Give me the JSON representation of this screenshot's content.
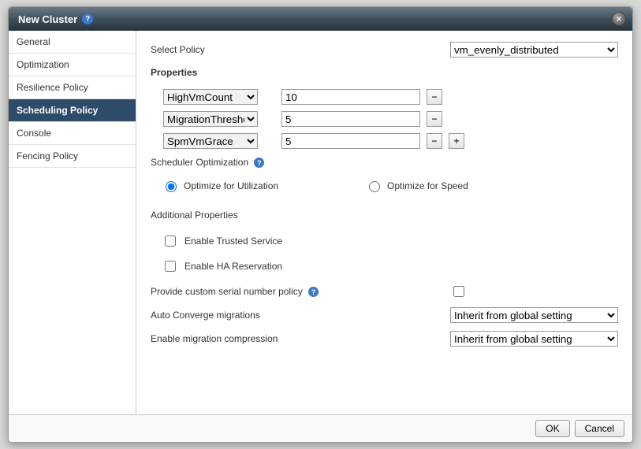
{
  "dialog": {
    "title": "New Cluster"
  },
  "sidebar": {
    "items": [
      {
        "label": "General"
      },
      {
        "label": "Optimization"
      },
      {
        "label": "Resilience Policy"
      },
      {
        "label": "Scheduling Policy"
      },
      {
        "label": "Console"
      },
      {
        "label": "Fencing Policy"
      }
    ],
    "active_index": 3
  },
  "content": {
    "select_policy_label": "Select Policy",
    "policy_value": "vm_evenly_distributed",
    "properties_title": "Properties",
    "properties": [
      {
        "key": "HighVmCount",
        "value": "10",
        "show_minus": true,
        "show_plus": false
      },
      {
        "key": "MigrationThreshold",
        "value": "5",
        "show_minus": true,
        "show_plus": false
      },
      {
        "key": "SpmVmGrace",
        "value": "5",
        "show_minus": true,
        "show_plus": true
      }
    ],
    "scheduler_opt_title": "Scheduler Optimization",
    "radio_utilization": "Optimize for Utilization",
    "radio_speed": "Optimize for Speed",
    "radio_selected": "utilization",
    "additional_title": "Additional Properties",
    "cb_trusted": "Enable Trusted Service",
    "cb_ha": "Enable HA Reservation",
    "serial_label": "Provide custom serial number policy",
    "serial_checked": false,
    "auto_converge_label": "Auto Converge migrations",
    "auto_converge_value": "Inherit from global setting",
    "migration_compression_label": "Enable migration compression",
    "migration_compression_value": "Inherit from global setting"
  },
  "footer": {
    "ok": "OK",
    "cancel": "Cancel"
  }
}
